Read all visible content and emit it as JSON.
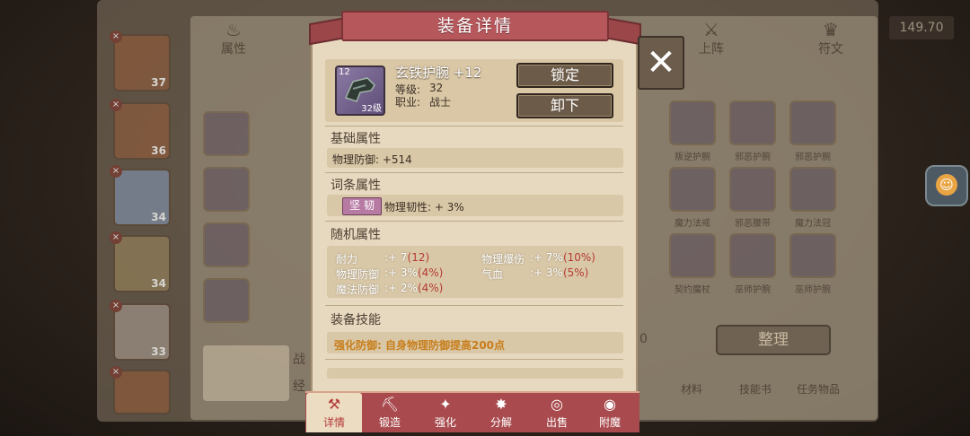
{
  "background": {
    "tabs": [
      {
        "label": "属性",
        "icon": "flame-icon"
      },
      {
        "label": "上阵",
        "icon": "crossed-swords-icon"
      },
      {
        "label": "符文",
        "icon": "rune-icon"
      }
    ],
    "currency_value": "149.70",
    "heroes": [
      {
        "level": "37"
      },
      {
        "level": "36"
      },
      {
        "level": "34"
      },
      {
        "level": "34"
      },
      {
        "level": "33"
      },
      {
        "level": ""
      }
    ],
    "inventory_labels": [
      "叛逆护腕",
      "邪恶护腕",
      "邪恶护腕",
      "魔力法戒",
      "邪恶腰带",
      "魔力法冠",
      "契约魔杖",
      "巫师护腕",
      "巫师护腕"
    ],
    "sort_button": "整理",
    "bottom_tabs": [
      "材料",
      "技能书",
      "任务物品"
    ],
    "count_fragment": "0",
    "partial_text": [
      "战",
      "经"
    ]
  },
  "dialog": {
    "title": "装备详情",
    "close_label": "✕",
    "item": {
      "name": "玄铁护腕 +12",
      "qty": "12",
      "level_badge": "32级",
      "level_label": "等级:",
      "level_value": "32",
      "job_label": "职业:",
      "job_value": "战士",
      "icon": "bracer-icon"
    },
    "buttons": {
      "lock": "锁定",
      "unequip": "卸下"
    },
    "sections": {
      "basic_title": "基础属性",
      "basic_attr": "物理防御: +514",
      "affix_title": "词条属性",
      "affix_tag": "坚 韧",
      "affix_attr": "物理韧性: + 3%",
      "random_title": "随机属性",
      "skill_title": "装备技能",
      "skill_text": "强化防御:  自身物理防御提高200点"
    },
    "random_attrs": [
      {
        "name": "耐力",
        "value": ":+ 7",
        "extra": "(12)"
      },
      {
        "name": "物理爆伤",
        "value": ":+ 7%",
        "extra": "(10%)"
      },
      {
        "name": "物理防御",
        "value": ":+ 3%",
        "extra": "(4%)"
      },
      {
        "name": "气血",
        "value": ":+ 3%",
        "extra": "(5%)"
      },
      {
        "name": "魔法防御",
        "value": ":+ 2%",
        "extra": "(4%)"
      }
    ],
    "tabs": [
      {
        "label": "详情",
        "icon": "hammer-icon",
        "active": true
      },
      {
        "label": "锻造",
        "icon": "anvil-icon",
        "active": false
      },
      {
        "label": "强化",
        "icon": "sparkle-icon",
        "active": false
      },
      {
        "label": "分解",
        "icon": "burst-icon",
        "active": false
      },
      {
        "label": "出售",
        "icon": "coins-icon",
        "active": false
      },
      {
        "label": "附魔",
        "icon": "eye-icon",
        "active": false
      }
    ]
  },
  "colors": {
    "accent_red": "#b5575b",
    "attr_red": "#b53a33",
    "skill_orange": "#c87d1b",
    "tag_purple": "#b77aa3"
  }
}
